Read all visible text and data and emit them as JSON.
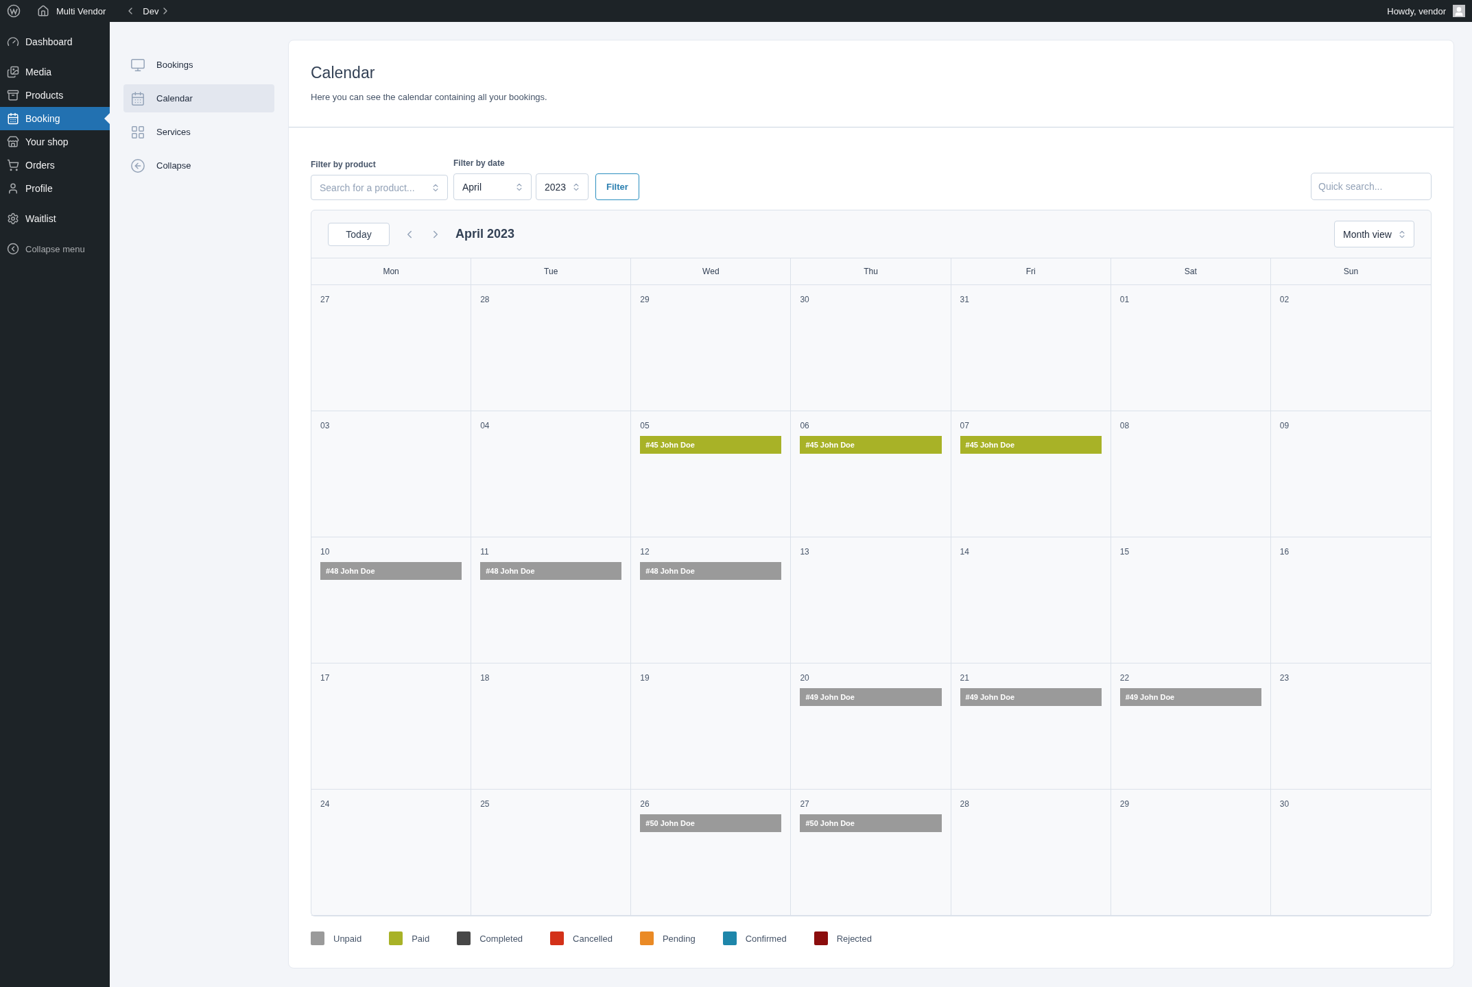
{
  "admin_bar": {
    "site": "Multi Vendor",
    "nav": "Dev",
    "greeting": "Howdy, vendor"
  },
  "sidebar": {
    "groups": [
      {
        "items": [
          {
            "label": "Dashboard",
            "selected": false
          }
        ]
      },
      {
        "items": [
          {
            "label": "Media",
            "selected": false
          },
          {
            "label": "Products",
            "selected": false
          },
          {
            "label": "Booking",
            "selected": true
          },
          {
            "label": "Your shop",
            "selected": false
          },
          {
            "label": "Orders",
            "selected": false
          },
          {
            "label": "Profile",
            "selected": false
          }
        ]
      },
      {
        "items": [
          {
            "label": "Waitlist",
            "selected": false
          }
        ]
      }
    ],
    "collapse": "Collapse menu"
  },
  "submenu": {
    "items": [
      {
        "label": "Bookings",
        "selected": false
      },
      {
        "label": "Calendar",
        "selected": true
      },
      {
        "label": "Services",
        "selected": false
      },
      {
        "label": "Collapse",
        "selected": false
      }
    ]
  },
  "page": {
    "title": "Calendar",
    "description": "Here you can see the calendar containing all your bookings."
  },
  "filters": {
    "product_label": "Filter by product",
    "product_placeholder": "Search for a product...",
    "date_label": "Filter by date",
    "month": "April",
    "year": "2023",
    "button": "Filter",
    "search_placeholder": "Quick search..."
  },
  "calendar": {
    "today": "Today",
    "title": "April 2023",
    "view": "Month view",
    "weekdays": [
      "Mon",
      "Tue",
      "Wed",
      "Thu",
      "Fri",
      "Sat",
      "Sun"
    ],
    "weeks": [
      [
        {
          "day": "27"
        },
        {
          "day": "28"
        },
        {
          "day": "29"
        },
        {
          "day": "30"
        },
        {
          "day": "31"
        },
        {
          "day": "01"
        },
        {
          "day": "02"
        }
      ],
      [
        {
          "day": "03"
        },
        {
          "day": "04"
        },
        {
          "day": "05",
          "events": [
            {
              "label": "#45 John Doe",
              "color": "#a8b227"
            }
          ]
        },
        {
          "day": "06",
          "events": [
            {
              "label": "#45 John Doe",
              "color": "#a8b227"
            }
          ]
        },
        {
          "day": "07",
          "events": [
            {
              "label": "#45 John Doe",
              "color": "#a8b227"
            }
          ]
        },
        {
          "day": "08"
        },
        {
          "day": "09"
        }
      ],
      [
        {
          "day": "10",
          "events": [
            {
              "label": "#48 John Doe",
              "color": "#9a9a9a"
            }
          ]
        },
        {
          "day": "11",
          "events": [
            {
              "label": "#48 John Doe",
              "color": "#9a9a9a"
            }
          ]
        },
        {
          "day": "12",
          "events": [
            {
              "label": "#48 John Doe",
              "color": "#9a9a9a"
            }
          ]
        },
        {
          "day": "13"
        },
        {
          "day": "14"
        },
        {
          "day": "15"
        },
        {
          "day": "16"
        }
      ],
      [
        {
          "day": "17"
        },
        {
          "day": "18"
        },
        {
          "day": "19"
        },
        {
          "day": "20",
          "events": [
            {
              "label": "#49 John Doe",
              "color": "#9a9a9a"
            }
          ]
        },
        {
          "day": "21",
          "events": [
            {
              "label": "#49 John Doe",
              "color": "#9a9a9a"
            }
          ]
        },
        {
          "day": "22",
          "events": [
            {
              "label": "#49 John Doe",
              "color": "#9a9a9a"
            }
          ]
        },
        {
          "day": "23"
        }
      ],
      [
        {
          "day": "24"
        },
        {
          "day": "25"
        },
        {
          "day": "26",
          "events": [
            {
              "label": "#50 John Doe",
              "color": "#9a9a9a"
            }
          ]
        },
        {
          "day": "27",
          "events": [
            {
              "label": "#50 John Doe",
              "color": "#9a9a9a"
            }
          ]
        },
        {
          "day": "28"
        },
        {
          "day": "29"
        },
        {
          "day": "30"
        }
      ]
    ]
  },
  "legend": [
    {
      "label": "Unpaid",
      "color": "#9a9a9a"
    },
    {
      "label": "Paid",
      "color": "#a8b227"
    },
    {
      "label": "Completed",
      "color": "#474747"
    },
    {
      "label": "Cancelled",
      "color": "#d33119"
    },
    {
      "label": "Pending",
      "color": "#ea8a25"
    },
    {
      "label": "Confirmed",
      "color": "#1e86aa"
    },
    {
      "label": "Rejected",
      "color": "#8b0d0d"
    }
  ]
}
